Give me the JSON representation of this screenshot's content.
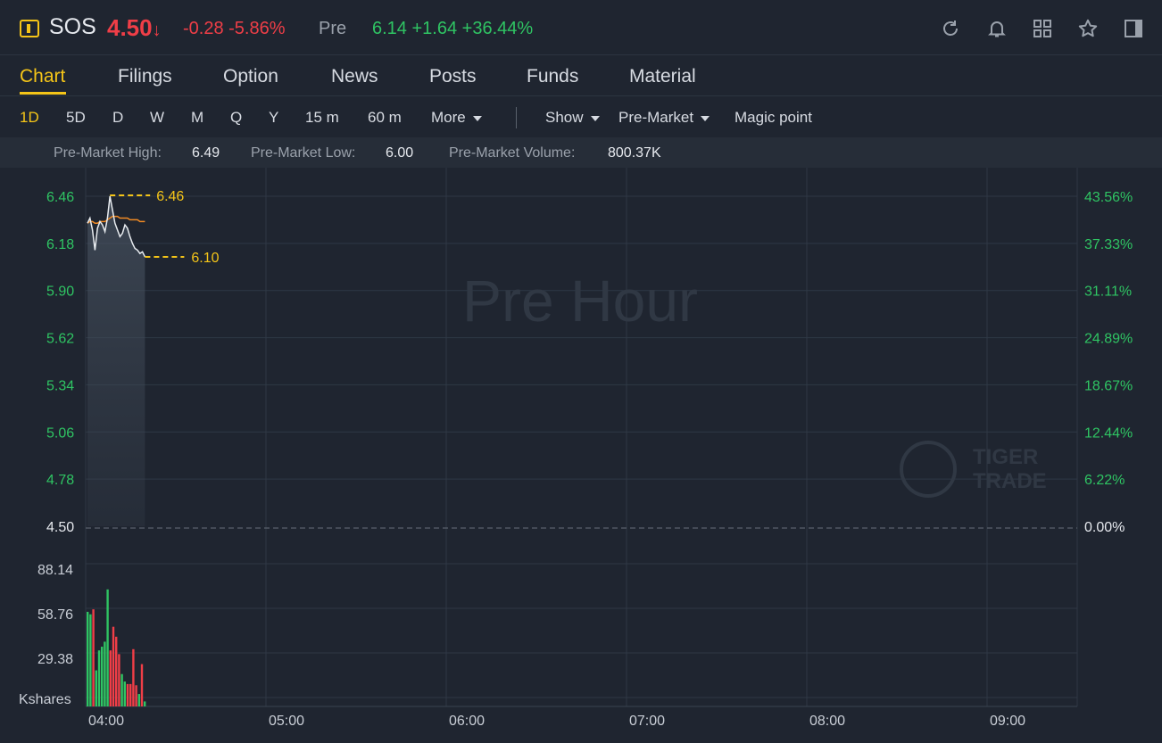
{
  "header": {
    "symbol": "SOS",
    "price": "4.50",
    "price_arrow": "↓",
    "change": "-0.28 -5.86%",
    "pre_label": "Pre",
    "pre_value": "6.14 +1.64 +36.44%",
    "icons": [
      "refresh-icon",
      "bell-icon",
      "grid-icon",
      "star-icon",
      "panel-icon"
    ]
  },
  "tabs": [
    "Chart",
    "Filings",
    "Option",
    "News",
    "Posts",
    "Funds",
    "Material"
  ],
  "toolbar": {
    "periods": [
      "1D",
      "5D",
      "D",
      "W",
      "M",
      "Q",
      "Y",
      "15 m",
      "60 m"
    ],
    "more": "More",
    "show": "Show",
    "session": "Pre-Market",
    "magic": "Magic point"
  },
  "stats": {
    "high_label": "Pre-Market High:",
    "high_value": "6.49",
    "low_label": "Pre-Market Low:",
    "low_value": "6.00",
    "volume_label": "Pre-Market Volume:",
    "volume_value": "800.37K"
  },
  "chart_data": {
    "type": "line",
    "watermark": "Pre Hour",
    "brand_watermark": [
      "TIGER",
      "TRADE"
    ],
    "price_ticks": [
      "6.46",
      "6.18",
      "5.90",
      "5.62",
      "5.34",
      "5.06",
      "4.78",
      "4.50"
    ],
    "pct_ticks": [
      "43.56%",
      "37.33%",
      "31.11%",
      "24.89%",
      "18.67%",
      "12.44%",
      "6.22%",
      "0.00%"
    ],
    "ylim": [
      4.5,
      6.46
    ],
    "volume_ticks": [
      "88.14",
      "58.76",
      "29.38"
    ],
    "volume_unit": "Kshares",
    "x_ticks": [
      "04:00",
      "05:00",
      "06:00",
      "07:00",
      "08:00",
      "09:00"
    ],
    "high_marker": "6.46",
    "last_marker": "6.10",
    "price_series": [
      6.3,
      6.33,
      6.26,
      6.14,
      6.27,
      6.31,
      6.29,
      6.25,
      6.33,
      6.46,
      6.38,
      6.3,
      6.26,
      6.22,
      6.24,
      6.29,
      6.27,
      6.22,
      6.18,
      6.15,
      6.14,
      6.12,
      6.13,
      6.1
    ],
    "avg_series": [
      6.3,
      6.31,
      6.31,
      6.3,
      6.3,
      6.31,
      6.31,
      6.31,
      6.32,
      6.33,
      6.34,
      6.34,
      6.34,
      6.33,
      6.33,
      6.33,
      6.33,
      6.32,
      6.32,
      6.32,
      6.32,
      6.31,
      6.31,
      6.31
    ],
    "volume_bars": [
      {
        "v": 76,
        "up": true
      },
      {
        "v": 74,
        "up": true
      },
      {
        "v": 78,
        "up": false
      },
      {
        "v": 29,
        "up": true
      },
      {
        "v": 45,
        "up": true
      },
      {
        "v": 48,
        "up": true
      },
      {
        "v": 52,
        "up": true
      },
      {
        "v": 94,
        "up": true
      },
      {
        "v": 45,
        "up": false
      },
      {
        "v": 64,
        "up": false
      },
      {
        "v": 56,
        "up": false
      },
      {
        "v": 42,
        "up": false
      },
      {
        "v": 26,
        "up": true
      },
      {
        "v": 20,
        "up": true
      },
      {
        "v": 18,
        "up": false
      },
      {
        "v": 18,
        "up": false
      },
      {
        "v": 46,
        "up": false
      },
      {
        "v": 17,
        "up": false
      },
      {
        "v": 10,
        "up": true
      },
      {
        "v": 34,
        "up": false
      },
      {
        "v": 4,
        "up": true
      }
    ],
    "x_range": [
      "04:00",
      "09:30"
    ],
    "grid": true
  },
  "colors": {
    "bg": "#1f2530",
    "up": "#2fc463",
    "down": "#f03e47",
    "accent": "#f5c518",
    "line": "#e8ecf0",
    "avg": "#f08a24"
  }
}
